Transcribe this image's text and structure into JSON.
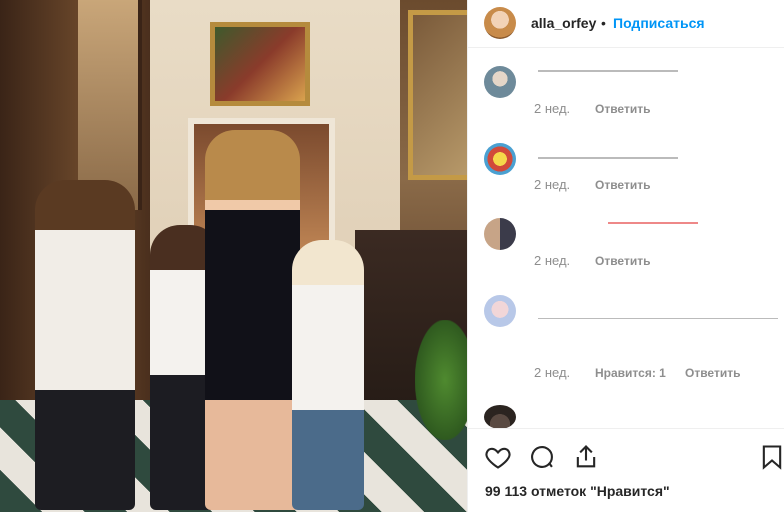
{
  "post": {
    "photo_alt": "",
    "likes": "99 113 отметок \"Нравится\""
  },
  "header": {
    "username": "alla_orfey",
    "separator": "•",
    "follow_label": "Подписаться"
  },
  "comments": [
    {
      "time": "2 нед.",
      "reply_label": "Ответить",
      "likes": ""
    },
    {
      "time": "2 нед.",
      "reply_label": "Ответить",
      "likes": ""
    },
    {
      "time": "2 нед.",
      "reply_label": "Ответить",
      "likes": ""
    },
    {
      "time": "2 нед.",
      "reply_label": "Ответить",
      "likes": "Нравится: 1"
    }
  ],
  "actions": {
    "like_icon": "heart-icon",
    "comment_icon": "comment-icon",
    "share_icon": "share-icon",
    "save_icon": "bookmark-icon"
  },
  "colors": {
    "accent": "#0095f6",
    "text": "#262626",
    "muted": "#8e8e8e"
  }
}
